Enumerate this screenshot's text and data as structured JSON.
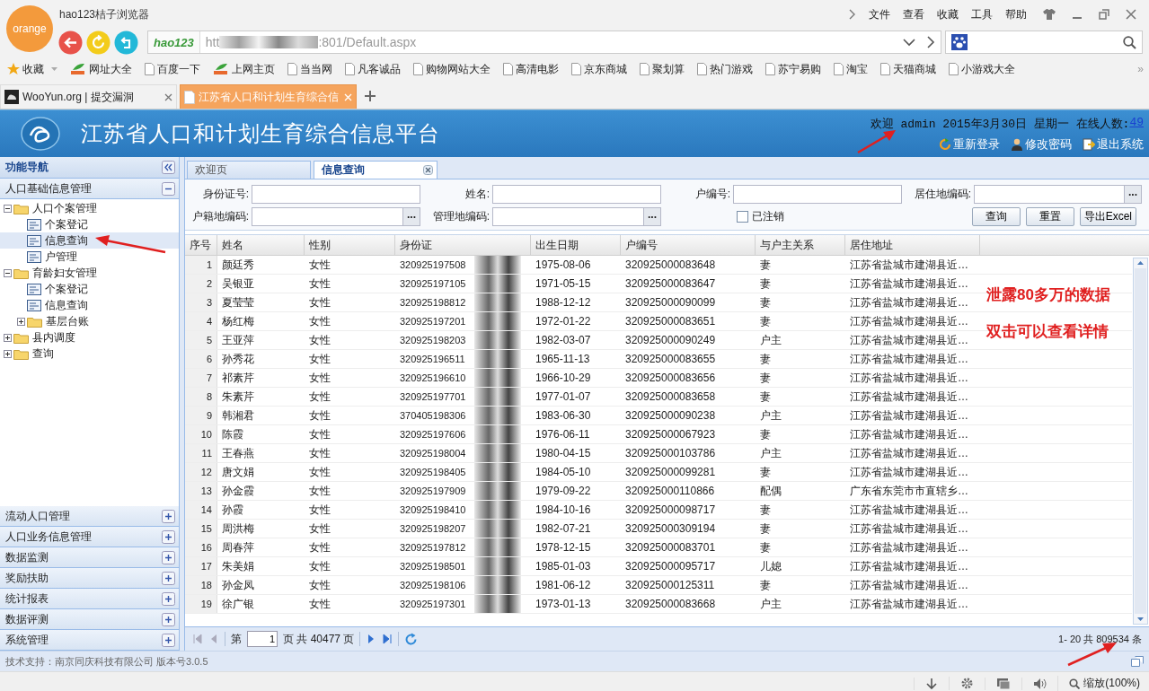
{
  "browser": {
    "logo": "orange",
    "app_name": "hao123桔子浏览器",
    "menu": [
      "文件",
      "查看",
      "收藏",
      "工具",
      "帮助"
    ],
    "address": {
      "brand": "hao123",
      "url_start": "htt",
      "url_end": ":801/Default.aspx"
    },
    "bookmarks": [
      {
        "label": "收藏",
        "kind": "star"
      },
      {
        "label": "网址大全",
        "kind": "hao"
      },
      {
        "label": "百度一下",
        "kind": "page"
      },
      {
        "label": "上网主页",
        "kind": "hao"
      },
      {
        "label": "当当网",
        "kind": "page"
      },
      {
        "label": "凡客诚品",
        "kind": "page"
      },
      {
        "label": "购物网站大全",
        "kind": "page"
      },
      {
        "label": "高清电影",
        "kind": "page"
      },
      {
        "label": "京东商城",
        "kind": "page"
      },
      {
        "label": "聚划算",
        "kind": "page"
      },
      {
        "label": "热门游戏",
        "kind": "page"
      },
      {
        "label": "苏宁易购",
        "kind": "page"
      },
      {
        "label": "淘宝",
        "kind": "page"
      },
      {
        "label": "天猫商城",
        "kind": "page"
      },
      {
        "label": "小游戏大全",
        "kind": "page"
      }
    ],
    "bookmarks_more": "»",
    "tabs": [
      {
        "title": "WooYun.org | 提交漏洞",
        "selected": false
      },
      {
        "title": "江苏省人口和计划生育综合信",
        "selected": true
      }
    ],
    "zoom": "缩放(100%)"
  },
  "header": {
    "title": "江苏省人口和计划生育综合信息平台",
    "welcome": "欢迎 admin 2015年3月30日 星期一 在线人数:",
    "online_count": "49",
    "actions": [
      "重新登录",
      "修改密码",
      "退出系统"
    ]
  },
  "sidebar": {
    "title": "功能导航",
    "sections": [
      {
        "label": "人口基础信息管理",
        "expanded": true,
        "tree": [
          {
            "label": "人口个案管理",
            "kind": "folder",
            "expanded": true,
            "selected": false,
            "children": [
              {
                "label": "个案登记",
                "kind": "page",
                "selected": false
              },
              {
                "label": "信息查询",
                "kind": "page",
                "selected": true
              },
              {
                "label": "户管理",
                "kind": "page",
                "selected": false
              }
            ]
          },
          {
            "label": "育龄妇女管理",
            "kind": "folder",
            "expanded": true,
            "selected": false,
            "children": [
              {
                "label": "个案登记",
                "kind": "page",
                "selected": false
              },
              {
                "label": "信息查询",
                "kind": "page",
                "selected": false
              },
              {
                "label": "基层台账",
                "kind": "folder",
                "expanded": false,
                "selected": false
              }
            ]
          },
          {
            "label": "县内调度",
            "kind": "folder",
            "expanded": false,
            "selected": false
          },
          {
            "label": "查询",
            "kind": "folder",
            "expanded": false,
            "selected": false
          }
        ]
      },
      {
        "label": "流动人口管理",
        "expanded": false
      },
      {
        "label": "人口业务信息管理",
        "expanded": false
      },
      {
        "label": "数据监测",
        "expanded": false
      },
      {
        "label": "奖励扶助",
        "expanded": false
      },
      {
        "label": "统计报表",
        "expanded": false
      },
      {
        "label": "数据评测",
        "expanded": false
      },
      {
        "label": "系统管理",
        "expanded": false
      }
    ]
  },
  "content_tabs": [
    {
      "label": "欢迎页",
      "selected": false,
      "closable": false
    },
    {
      "label": "信息查询",
      "selected": true,
      "closable": true
    }
  ],
  "search_form": {
    "fields": [
      {
        "label": "身份证号:",
        "kind": "text"
      },
      {
        "label": "姓名:",
        "kind": "text"
      },
      {
        "label": "户编号:",
        "kind": "text"
      },
      {
        "label": "居住地编码:",
        "kind": "picker",
        "button": "..."
      },
      {
        "label": "户籍地编码:",
        "kind": "picker",
        "button": "..."
      },
      {
        "label": "管理地编码:",
        "kind": "picker",
        "button": "..."
      }
    ],
    "checkbox": {
      "label": "已注销",
      "checked": false
    },
    "buttons": [
      "查询",
      "重置",
      "导出Excel"
    ]
  },
  "grid": {
    "columns": [
      {
        "label": "序号",
        "kind": "rownum"
      },
      {
        "label": "姓名",
        "kind": "text"
      },
      {
        "label": "性别",
        "kind": "text"
      },
      {
        "label": "身份证",
        "kind": "masked"
      },
      {
        "label": "出生日期",
        "kind": "text"
      },
      {
        "label": "户编号",
        "kind": "text"
      },
      {
        "label": "与户主关系",
        "kind": "text"
      },
      {
        "label": "居住地址",
        "kind": "text"
      }
    ],
    "rows": [
      [
        "1",
        "颜廷秀",
        "女性",
        "320925197508",
        "1975-08-06",
        "320925000083648",
        "妻",
        "江苏省盐城市建湖县近…"
      ],
      [
        "2",
        "吴银亚",
        "女性",
        "320925197105",
        "1971-05-15",
        "320925000083647",
        "妻",
        "江苏省盐城市建湖县近…"
      ],
      [
        "3",
        "夏莹莹",
        "女性",
        "320925198812",
        "1988-12-12",
        "320925000090099",
        "妻",
        "江苏省盐城市建湖县近…"
      ],
      [
        "4",
        "杨红梅",
        "女性",
        "320925197201",
        "1972-01-22",
        "320925000083651",
        "妻",
        "江苏省盐城市建湖县近…"
      ],
      [
        "5",
        "王亚萍",
        "女性",
        "320925198203",
        "1982-03-07",
        "320925000090249",
        "户主",
        "江苏省盐城市建湖县近…"
      ],
      [
        "6",
        "孙秀花",
        "女性",
        "320925196511",
        "1965-11-13",
        "320925000083655",
        "妻",
        "江苏省盐城市建湖县近…"
      ],
      [
        "7",
        "祁素芹",
        "女性",
        "320925196610",
        "1966-10-29",
        "320925000083656",
        "妻",
        "江苏省盐城市建湖县近…"
      ],
      [
        "8",
        "朱素芹",
        "女性",
        "320925197701",
        "1977-01-07",
        "320925000083658",
        "妻",
        "江苏省盐城市建湖县近…"
      ],
      [
        "9",
        "韩湘君",
        "女性",
        "370405198306",
        "1983-06-30",
        "320925000090238",
        "户主",
        "江苏省盐城市建湖县近…"
      ],
      [
        "10",
        "陈霞",
        "女性",
        "320925197606",
        "1976-06-11",
        "320925000067923",
        "妻",
        "江苏省盐城市建湖县近…"
      ],
      [
        "11",
        "王春燕",
        "女性",
        "320925198004",
        "1980-04-15",
        "320925000103786",
        "户主",
        "江苏省盐城市建湖县近…"
      ],
      [
        "12",
        "唐文娟",
        "女性",
        "320925198405",
        "1984-05-10",
        "320925000099281",
        "妻",
        "江苏省盐城市建湖县近…"
      ],
      [
        "13",
        "孙金霞",
        "女性",
        "320925197909",
        "1979-09-22",
        "320925000110866",
        "配偶",
        "广东省东莞市市直辖乡…"
      ],
      [
        "14",
        "孙霞",
        "女性",
        "320925198410",
        "1984-10-16",
        "320925000098717",
        "妻",
        "江苏省盐城市建湖县近…"
      ],
      [
        "15",
        "周洪梅",
        "女性",
        "320925198207",
        "1982-07-21",
        "320925000309194",
        "妻",
        "江苏省盐城市建湖县近…"
      ],
      [
        "16",
        "周春萍",
        "女性",
        "320925197812",
        "1978-12-15",
        "320925000083701",
        "妻",
        "江苏省盐城市建湖县近…"
      ],
      [
        "17",
        "朱美娟",
        "女性",
        "320925198501",
        "1985-01-03",
        "320925000095717",
        "儿媳",
        "江苏省盐城市建湖县近…"
      ],
      [
        "18",
        "孙金凤",
        "女性",
        "320925198106",
        "1981-06-12",
        "320925000125311",
        "妻",
        "江苏省盐城市建湖县近…"
      ],
      [
        "19",
        "徐广银",
        "女性",
        "320925197301",
        "1973-01-13",
        "320925000083668",
        "户主",
        "江苏省盐城市建湖县近…"
      ]
    ]
  },
  "pager": {
    "before": "第",
    "page": "1",
    "after": "页 共 40477 页",
    "summary": "1- 20 共 809534 条"
  },
  "annotations": [
    "泄露80多万的数据",
    "双击可以查看详情"
  ],
  "footer": "技术支持：南京同庆科技有限公司  版本号3.0.5"
}
